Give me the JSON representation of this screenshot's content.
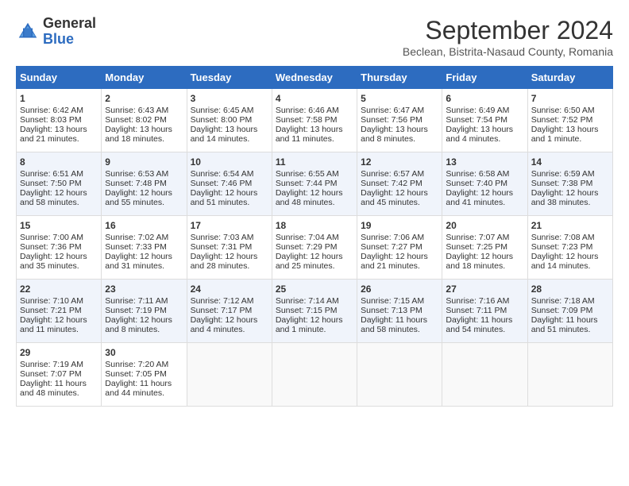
{
  "logo": {
    "general": "General",
    "blue": "Blue"
  },
  "title": "September 2024",
  "subtitle": "Beclean, Bistrita-Nasaud County, Romania",
  "days_header": [
    "Sunday",
    "Monday",
    "Tuesday",
    "Wednesday",
    "Thursday",
    "Friday",
    "Saturday"
  ],
  "weeks": [
    [
      {
        "day": "1",
        "sunrise": "6:42 AM",
        "sunset": "8:03 PM",
        "daylight": "13 hours and 21 minutes."
      },
      {
        "day": "2",
        "sunrise": "6:43 AM",
        "sunset": "8:02 PM",
        "daylight": "13 hours and 18 minutes."
      },
      {
        "day": "3",
        "sunrise": "6:45 AM",
        "sunset": "8:00 PM",
        "daylight": "13 hours and 14 minutes."
      },
      {
        "day": "4",
        "sunrise": "6:46 AM",
        "sunset": "7:58 PM",
        "daylight": "13 hours and 11 minutes."
      },
      {
        "day": "5",
        "sunrise": "6:47 AM",
        "sunset": "7:56 PM",
        "daylight": "13 hours and 8 minutes."
      },
      {
        "day": "6",
        "sunrise": "6:49 AM",
        "sunset": "7:54 PM",
        "daylight": "13 hours and 4 minutes."
      },
      {
        "day": "7",
        "sunrise": "6:50 AM",
        "sunset": "7:52 PM",
        "daylight": "13 hours and 1 minute."
      }
    ],
    [
      {
        "day": "8",
        "sunrise": "6:51 AM",
        "sunset": "7:50 PM",
        "daylight": "12 hours and 58 minutes."
      },
      {
        "day": "9",
        "sunrise": "6:53 AM",
        "sunset": "7:48 PM",
        "daylight": "12 hours and 55 minutes."
      },
      {
        "day": "10",
        "sunrise": "6:54 AM",
        "sunset": "7:46 PM",
        "daylight": "12 hours and 51 minutes."
      },
      {
        "day": "11",
        "sunrise": "6:55 AM",
        "sunset": "7:44 PM",
        "daylight": "12 hours and 48 minutes."
      },
      {
        "day": "12",
        "sunrise": "6:57 AM",
        "sunset": "7:42 PM",
        "daylight": "12 hours and 45 minutes."
      },
      {
        "day": "13",
        "sunrise": "6:58 AM",
        "sunset": "7:40 PM",
        "daylight": "12 hours and 41 minutes."
      },
      {
        "day": "14",
        "sunrise": "6:59 AM",
        "sunset": "7:38 PM",
        "daylight": "12 hours and 38 minutes."
      }
    ],
    [
      {
        "day": "15",
        "sunrise": "7:00 AM",
        "sunset": "7:36 PM",
        "daylight": "12 hours and 35 minutes."
      },
      {
        "day": "16",
        "sunrise": "7:02 AM",
        "sunset": "7:33 PM",
        "daylight": "12 hours and 31 minutes."
      },
      {
        "day": "17",
        "sunrise": "7:03 AM",
        "sunset": "7:31 PM",
        "daylight": "12 hours and 28 minutes."
      },
      {
        "day": "18",
        "sunrise": "7:04 AM",
        "sunset": "7:29 PM",
        "daylight": "12 hours and 25 minutes."
      },
      {
        "day": "19",
        "sunrise": "7:06 AM",
        "sunset": "7:27 PM",
        "daylight": "12 hours and 21 minutes."
      },
      {
        "day": "20",
        "sunrise": "7:07 AM",
        "sunset": "7:25 PM",
        "daylight": "12 hours and 18 minutes."
      },
      {
        "day": "21",
        "sunrise": "7:08 AM",
        "sunset": "7:23 PM",
        "daylight": "12 hours and 14 minutes."
      }
    ],
    [
      {
        "day": "22",
        "sunrise": "7:10 AM",
        "sunset": "7:21 PM",
        "daylight": "12 hours and 11 minutes."
      },
      {
        "day": "23",
        "sunrise": "7:11 AM",
        "sunset": "7:19 PM",
        "daylight": "12 hours and 8 minutes."
      },
      {
        "day": "24",
        "sunrise": "7:12 AM",
        "sunset": "7:17 PM",
        "daylight": "12 hours and 4 minutes."
      },
      {
        "day": "25",
        "sunrise": "7:14 AM",
        "sunset": "7:15 PM",
        "daylight": "12 hours and 1 minute."
      },
      {
        "day": "26",
        "sunrise": "7:15 AM",
        "sunset": "7:13 PM",
        "daylight": "11 hours and 58 minutes."
      },
      {
        "day": "27",
        "sunrise": "7:16 AM",
        "sunset": "7:11 PM",
        "daylight": "11 hours and 54 minutes."
      },
      {
        "day": "28",
        "sunrise": "7:18 AM",
        "sunset": "7:09 PM",
        "daylight": "11 hours and 51 minutes."
      }
    ],
    [
      {
        "day": "29",
        "sunrise": "7:19 AM",
        "sunset": "7:07 PM",
        "daylight": "11 hours and 48 minutes."
      },
      {
        "day": "30",
        "sunrise": "7:20 AM",
        "sunset": "7:05 PM",
        "daylight": "11 hours and 44 minutes."
      },
      null,
      null,
      null,
      null,
      null
    ]
  ]
}
